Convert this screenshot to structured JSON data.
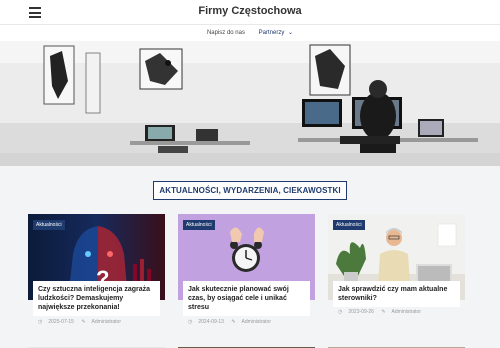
{
  "header": {
    "title": "Firmy Częstochowa"
  },
  "nav": {
    "items": [
      "Napisz do nas",
      "Partnerzy"
    ]
  },
  "section": {
    "title": "AKTUALNOŚCI, WYDARZENIA, CIEKAWOSTKI"
  },
  "cards": [
    {
      "category": "Aktualności",
      "title": "Czy sztuczna inteligencja zagraża ludzkości? Demaskujemy największe przekonania!",
      "date": "2025-07-15",
      "author": "Administrator"
    },
    {
      "category": "Aktualności",
      "title": "Jak skutecznie planować swój czas, by osiągać cele i unikać stresu",
      "date": "2024-09-13",
      "author": "Administrator"
    },
    {
      "category": "Aktualności",
      "title": "Jak sprawdzić czy mam aktualne sterowniki?",
      "date": "2023-09-26",
      "author": "Administrator"
    }
  ],
  "colors": {
    "accent": "#1e3a6e",
    "background": "#f3f4f6"
  }
}
